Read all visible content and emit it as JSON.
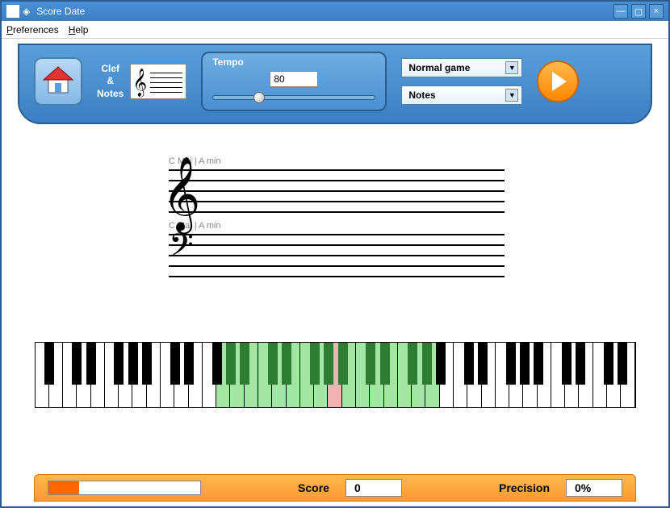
{
  "window": {
    "title": "Score Date"
  },
  "menubar": {
    "preferences": "Preferences",
    "help": "Help"
  },
  "toolbar": {
    "clef_label_1": "Clef",
    "clef_label_2": "&",
    "clef_label_3": "Notes",
    "tempo_label": "Tempo",
    "tempo_value": "80",
    "mode_select": "Normal game",
    "type_select": "Notes"
  },
  "staff": {
    "treble_key": "C Maj | A min",
    "bass_key": "C Maj | A min"
  },
  "status": {
    "score_label": "Score",
    "score_value": "0",
    "precision_label": "Precision",
    "precision_value": "0%"
  },
  "keyboard": {
    "white_count": 43,
    "green_range": [
      13,
      28
    ],
    "pink_index": 21,
    "black_pattern": [
      1,
      1,
      0,
      1,
      1,
      1,
      0
    ]
  }
}
